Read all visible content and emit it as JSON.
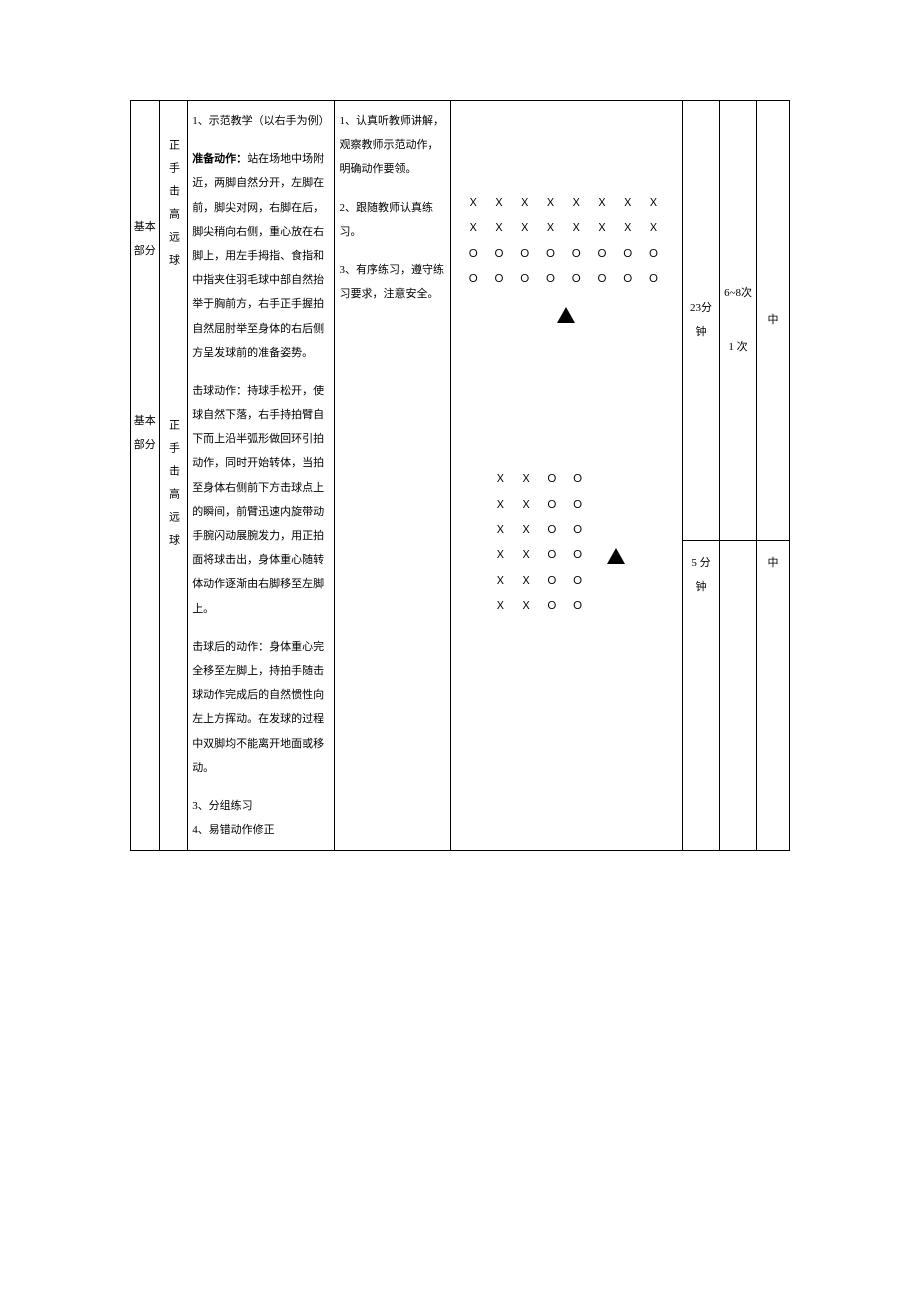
{
  "rows": [
    {
      "sectionLabel": "基本部分",
      "contentLabel": "正手击高远球",
      "teaching": {
        "item1": "1、示范教学（以右手为例）",
        "prepLabel": "准备动作：",
        "prepText": "站在场地中场附近，两脚自然分开，左脚在前，脚尖对网，右脚在后，脚尖稍向右侧，重心放在右脚上，用左手拇指、食指和中指夹住羽毛球中部自然抬举于胸前方，右手正手握拍自然屈肘举至身体的右后侧方呈发球前的准备姿势。"
      },
      "student": {
        "s1": "1、认真听教师讲解，观察教师示范动作，明确动作要领。",
        "s2": "2、跟随教师认真练习。",
        "s3": "3、有序练习，遵守练习要求，注意安全。"
      },
      "diagram": {
        "l1": "Ｘ Ｘ Ｘ Ｘ Ｘ Ｘ Ｘ Ｘ",
        "l2": "Ｘ Ｘ Ｘ Ｘ Ｘ Ｘ Ｘ Ｘ",
        "l3": "Ｏ Ｏ Ｏ Ｏ Ｏ Ｏ Ｏ Ｏ",
        "l4": "Ｏ Ｏ Ｏ Ｏ Ｏ Ｏ Ｏ Ｏ"
      },
      "time1": "23分钟",
      "time2": "5 分钟",
      "reps1": "6~8次",
      "reps2": "1 次",
      "intensity1": "中",
      "intensity2": "中"
    },
    {
      "sectionLabel": "基本部分",
      "contentLabel": "正手击高远球",
      "teaching": {
        "hitLabel": "击球动作：",
        "hitText": "持球手松开，使球自然下落，右手持拍臂自下而上沿半弧形做回环引拍动作，同时开始转体，当拍至身体右侧前下方击球点上的瞬间，前臂迅速内旋带动手腕闪动展腕发力，用正拍面将球击出，身体重心随转体动作逐渐由右脚移至左脚上。",
        "afterLabel": "击球后的动作：",
        "afterText": "身体重心完全移至左脚上，持拍手随击球动作完成后的自然惯性向左上方挥动。在发球的过程中双脚均不能离开地面或移动。",
        "item3": "3、分组练习",
        "item4": "4、易错动作修正"
      },
      "diagram": {
        "l1": "Ｘ Ｘ Ｏ Ｏ",
        "l2": "Ｘ Ｘ Ｏ Ｏ",
        "l3": "Ｘ Ｘ Ｏ Ｏ",
        "l4": "Ｘ Ｘ Ｏ Ｏ",
        "l5": "Ｘ Ｘ Ｏ Ｏ",
        "l6": "Ｘ Ｘ Ｏ Ｏ"
      }
    }
  ]
}
